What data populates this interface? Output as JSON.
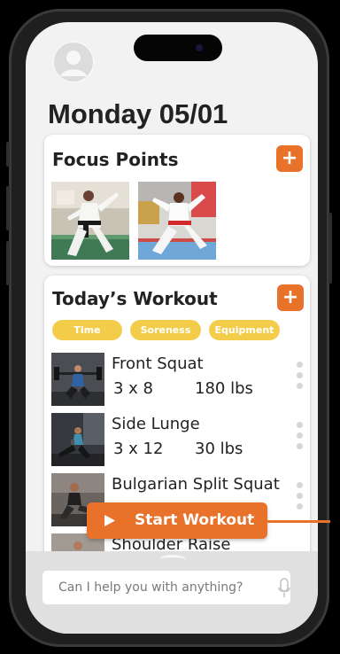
{
  "header": {
    "date_title": "Monday 05/01"
  },
  "focus_points": {
    "title": "Focus Points",
    "add_label": "+"
  },
  "workout": {
    "title": "Today’s Workout",
    "add_label": "+",
    "filters": [
      "Time",
      "Soreness",
      "Equipment"
    ],
    "exercises": [
      {
        "name": "Front Squat",
        "sets": "3 x 8",
        "weight": "180 lbs"
      },
      {
        "name": "Side Lunge",
        "sets": "3 x 12",
        "weight": "30 lbs"
      },
      {
        "name": "Bulgarian Split Squat",
        "sets": "",
        "weight": ""
      },
      {
        "name": "Shoulder Raise",
        "sets": "",
        "weight": ""
      }
    ]
  },
  "start_button": {
    "label": "Start Workout"
  },
  "assistant": {
    "placeholder": "Can I help you with anything?"
  },
  "colors": {
    "accent": "#e8722a",
    "chip": "#f3cd4a",
    "background": "#f2f2f2"
  },
  "icons": [
    "user-avatar-icon",
    "plus-icon",
    "play-icon",
    "drag-handle-icon",
    "microphone-icon"
  ]
}
